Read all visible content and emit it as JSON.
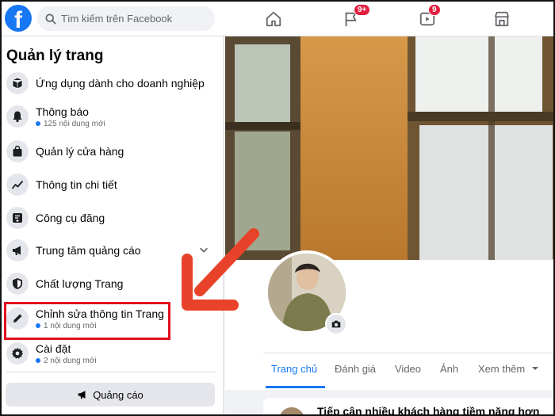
{
  "topbar": {
    "logo": "f",
    "search_placeholder": "Tìm kiếm trên Facebook",
    "nav": [
      {
        "icon": "home-icon"
      },
      {
        "icon": "flag-icon",
        "badge": "9+"
      },
      {
        "icon": "video-icon",
        "badge": "9"
      },
      {
        "icon": "marketplace-icon"
      }
    ]
  },
  "sidebar": {
    "title": "Quản lý trang",
    "items": [
      {
        "label": "Ứng dụng dành cho doanh nghiệp",
        "icon": "box-icon"
      },
      {
        "label": "Thông báo",
        "sub": "125 nội dung mới",
        "icon": "bell-icon"
      },
      {
        "label": "Quản lý cửa hàng",
        "icon": "shopping-bag-icon"
      },
      {
        "label": "Thông tin chi tiết",
        "icon": "trend-chart-icon"
      },
      {
        "label": "Công cụ đăng",
        "icon": "publishing-tools-icon"
      },
      {
        "label": "Trung tâm quảng cáo",
        "icon": "megaphone-icon"
      },
      {
        "label": "Chất lượng Trang",
        "icon": "shield-icon"
      },
      {
        "label": "Chỉnh sửa thông tin Trang",
        "sub": "1 nội dung mới",
        "icon": "pencil-icon"
      },
      {
        "label": "Cài đặt",
        "sub": "2 nội dung mới",
        "icon": "gear-icon"
      }
    ],
    "ad_button": "Quảng cáo"
  },
  "profile": {
    "tabs": [
      "Trang chủ",
      "Đánh giá",
      "Video",
      "Ảnh",
      "Xem thêm"
    ],
    "active_tab": "Trang chủ",
    "post_preview": "Tiếp cận nhiều khách hàng tiềm năng hơn"
  },
  "colors": {
    "accent": "#1877f2",
    "highlight": "#e3101f",
    "arrow": "#e8432a"
  }
}
